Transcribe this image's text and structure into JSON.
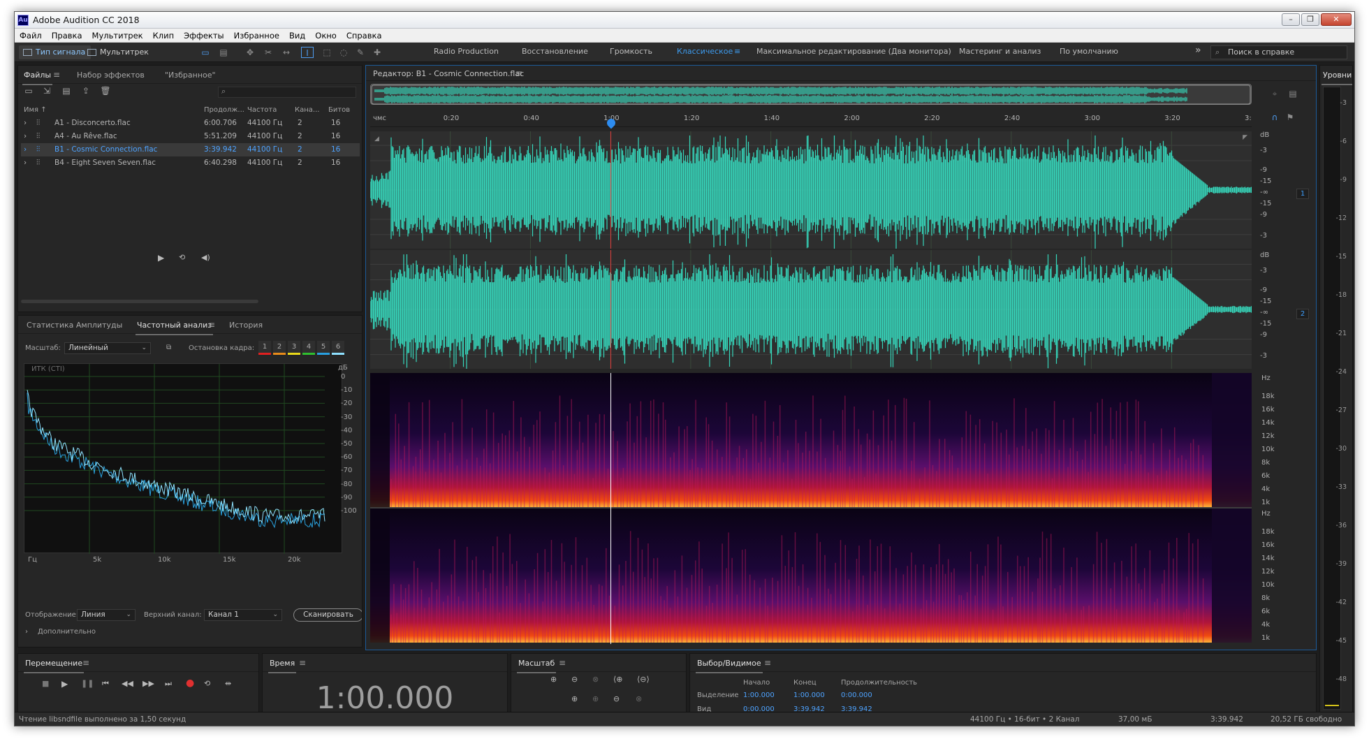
{
  "window": {
    "title": "Adobe Audition CC 2018",
    "app_icon": "Au",
    "buttons": [
      "–",
      "❐",
      "✕"
    ]
  },
  "menu": [
    "Файл",
    "Правка",
    "Мультитрек",
    "Клип",
    "Эффекты",
    "Избранное",
    "Вид",
    "Окно",
    "Справка"
  ],
  "toolbar": {
    "mode_waveform": "Тип сигнала",
    "mode_multitrack": "Мультитрек",
    "workspaces": [
      "Radio Production",
      "Восстановление",
      "Громкость",
      "Классическое",
      "Максимальное редактирование (Два монитора)",
      "Мастеринг и анализ",
      "По умолчанию"
    ],
    "active_workspace": "Классическое",
    "overflow": "»",
    "help_placeholder": "Поиск в справке"
  },
  "files_panel": {
    "tabs": [
      "Файлы",
      "Набор эффектов",
      "\"Избранное\""
    ],
    "columns": [
      "Имя ↑",
      "Продолж...",
      "Частота",
      "Кана...",
      "Битов"
    ],
    "files": [
      {
        "name": "A1 - Disconcerto.flac",
        "duration": "6:00.706",
        "rate": "44100 Гц",
        "channels": "2",
        "bits": "16",
        "selected": false
      },
      {
        "name": "A4 - Au Rêve.flac",
        "duration": "5:51.209",
        "rate": "44100 Гц",
        "channels": "2",
        "bits": "16",
        "selected": false
      },
      {
        "name": "B1 - Cosmic Connection.flac",
        "duration": "3:39.942",
        "rate": "44100 Гц",
        "channels": "2",
        "bits": "16",
        "selected": true
      },
      {
        "name": "B4 - Eight Seven Seven.flac",
        "duration": "6:40.298",
        "rate": "44100 Гц",
        "channels": "2",
        "bits": "16",
        "selected": false
      }
    ]
  },
  "freq_panel": {
    "tabs": [
      "Статистика Амплитуды",
      "Частотный анализ",
      "История"
    ],
    "scale_label": "Масштаб:",
    "scale_value": "Линейный",
    "freeze_label": "Остановка кадра:",
    "freeze_slots": [
      "1",
      "2",
      "3",
      "4",
      "5",
      "6"
    ],
    "freeze_colors": [
      "#e02020",
      "#e88b1a",
      "#e8d81a",
      "#2fbf2f",
      "#29a0e0",
      "#8ee0ff"
    ],
    "graph_label": "ИТК (СТI)",
    "db_unit": "дБ",
    "db_ticks": [
      "0",
      "-10",
      "-20",
      "-30",
      "-40",
      "-50",
      "-60",
      "-70",
      "-80",
      "-90",
      "-100"
    ],
    "freq_ticks": [
      "Гц",
      "5k",
      "10k",
      "15k",
      "20k"
    ],
    "display_label": "Отображение:",
    "display_value": "Линия",
    "channel_label": "Верхний канал:",
    "channel_value": "Канал 1",
    "scan_button": "Сканировать",
    "advanced": "Дополнительно"
  },
  "editor": {
    "title": "Редактор: B1 - Cosmic Connection.flac",
    "time_unit": "чмс",
    "time_ticks": [
      "0:20",
      "0:40",
      "1:00",
      "1:20",
      "1:40",
      "2:00",
      "2:20",
      "2:40",
      "3:00",
      "3:20",
      "3:"
    ],
    "playhead_fraction": 0.273,
    "db_label": "dB",
    "db_ticks_ch": [
      "-3",
      "-9",
      "-15",
      "-∞",
      "-15",
      "-9",
      "-3"
    ],
    "hz_label": "Hz",
    "hz_ticks": [
      "18k",
      "16k",
      "14k",
      "12k",
      "10k",
      "8k",
      "6k",
      "4k",
      "1k"
    ],
    "channels": [
      "1",
      "2"
    ],
    "wave_color": "#36d9bd"
  },
  "levels": {
    "title": "Уровни",
    "ticks": [
      "-3",
      "-6",
      "-9",
      "-12",
      "-15",
      "-18",
      "-21",
      "-24",
      "-27",
      "-30",
      "-33",
      "-36",
      "-39",
      "-42",
      "-45",
      "-48"
    ]
  },
  "transport": {
    "title": "Перемещение"
  },
  "time_panel": {
    "title": "Время",
    "value": "1:00.000"
  },
  "zoom_panel": {
    "title": "Масштаб"
  },
  "selection_panel": {
    "title": "Выбор/Видимое",
    "headers": [
      "Начало",
      "Конец",
      "Продолжительность"
    ],
    "rows": [
      {
        "label": "Выделение",
        "start": "1:00.000",
        "end": "1:00.000",
        "duration": "0:00.000"
      },
      {
        "label": "Вид",
        "start": "0:00.000",
        "end": "3:39.942",
        "duration": "3:39.942"
      }
    ]
  },
  "status": {
    "message": "Чтение libsndfile выполнено за 1,50 секунд",
    "format": "44100 Гц • 16-бит • 2 Канал",
    "size": "37,00 мБ",
    "duration": "3:39.942",
    "free": "20,52 ГБ свободно"
  }
}
